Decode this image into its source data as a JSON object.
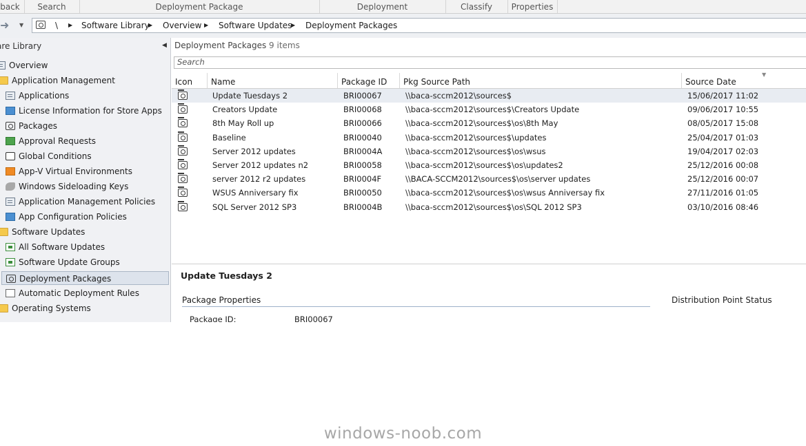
{
  "ribbon": {
    "groups": [
      "back",
      "Search",
      "Deployment Package",
      "Deployment",
      "Classify",
      "Properties"
    ]
  },
  "breadcrumb": {
    "items": [
      "\\",
      "Software Library",
      "Overview",
      "Software Updates",
      "Deployment Packages"
    ]
  },
  "sidebar": {
    "title": "are Library",
    "items": [
      {
        "label": "Overview",
        "icon": "overview-icon"
      },
      {
        "label": "Application Management",
        "icon": "folder-icon"
      },
      {
        "label": "Applications",
        "icon": "applications-icon"
      },
      {
        "label": "License Information for Store Apps",
        "icon": "license-icon"
      },
      {
        "label": "Packages",
        "icon": "package-icon"
      },
      {
        "label": "Approval Requests",
        "icon": "approval-icon"
      },
      {
        "label": "Global Conditions",
        "icon": "global-conditions-icon"
      },
      {
        "label": "App-V Virtual Environments",
        "icon": "appv-icon"
      },
      {
        "label": "Windows Sideloading Keys",
        "icon": "key-icon"
      },
      {
        "label": "Application Management Policies",
        "icon": "policy-icon"
      },
      {
        "label": "App Configuration Policies",
        "icon": "config-policy-icon"
      },
      {
        "label": "Software Updates",
        "icon": "folder-icon"
      },
      {
        "label": "All Software Updates",
        "icon": "software-update-icon"
      },
      {
        "label": "Software Update Groups",
        "icon": "update-group-icon"
      },
      {
        "label": "Deployment Packages",
        "icon": "package-icon"
      },
      {
        "label": "Automatic Deployment Rules",
        "icon": "rule-icon"
      },
      {
        "label": "Operating Systems",
        "icon": "folder-icon"
      }
    ]
  },
  "main": {
    "title": "Deployment Packages",
    "count": "9 items",
    "search_placeholder": "Search",
    "columns": [
      "Icon",
      "Name",
      "Package ID",
      "Pkg Source Path",
      "Source Date"
    ],
    "rows": [
      {
        "name": "Update Tuesdays 2",
        "id": "BRI00067",
        "path": "\\\\baca-sccm2012\\sources$",
        "date": "15/06/2017 11:02"
      },
      {
        "name": "Creators Update",
        "id": "BRI00068",
        "path": "\\\\baca-sccm2012\\sources$\\Creators Update",
        "date": "09/06/2017 10:55"
      },
      {
        "name": "8th May Roll up",
        "id": "BRI00066",
        "path": "\\\\baca-sccm2012\\sources$\\os\\8th May",
        "date": "08/05/2017 15:08"
      },
      {
        "name": "Baseline",
        "id": "BRI00040",
        "path": "\\\\baca-sccm2012\\sources$\\updates",
        "date": "25/04/2017 01:03"
      },
      {
        "name": "Server 2012 updates",
        "id": "BRI0004A",
        "path": "\\\\baca-sccm2012\\sources$\\os\\wsus",
        "date": "19/04/2017 02:03"
      },
      {
        "name": "Server 2012 updates n2",
        "id": "BRI00058",
        "path": "\\\\baca-sccm2012\\sources$\\os\\updates2",
        "date": "25/12/2016 00:08"
      },
      {
        "name": "server 2012 r2 updates",
        "id": "BRI0004F",
        "path": "\\\\BACA-SCCM2012\\sources$\\os\\server updates",
        "date": "25/12/2016 00:07"
      },
      {
        "name": "WSUS Anniversary fix",
        "id": "BRI00050",
        "path": "\\\\baca-sccm2012\\sources$\\os\\wsus Anniversay fix",
        "date": "27/11/2016 01:05"
      },
      {
        "name": "SQL Server 2012 SP3",
        "id": "BRI0004B",
        "path": "\\\\baca-sccm2012\\sources$\\os\\SQL 2012 SP3",
        "date": "03/10/2016 08:46"
      }
    ]
  },
  "details": {
    "title": "Update Tuesdays 2",
    "section_properties": "Package Properties",
    "section_distribution": "Distribution Point Status",
    "package_id_label": "Package ID:",
    "package_id_value": "BRI00067"
  },
  "watermark": "windows-noob.com"
}
